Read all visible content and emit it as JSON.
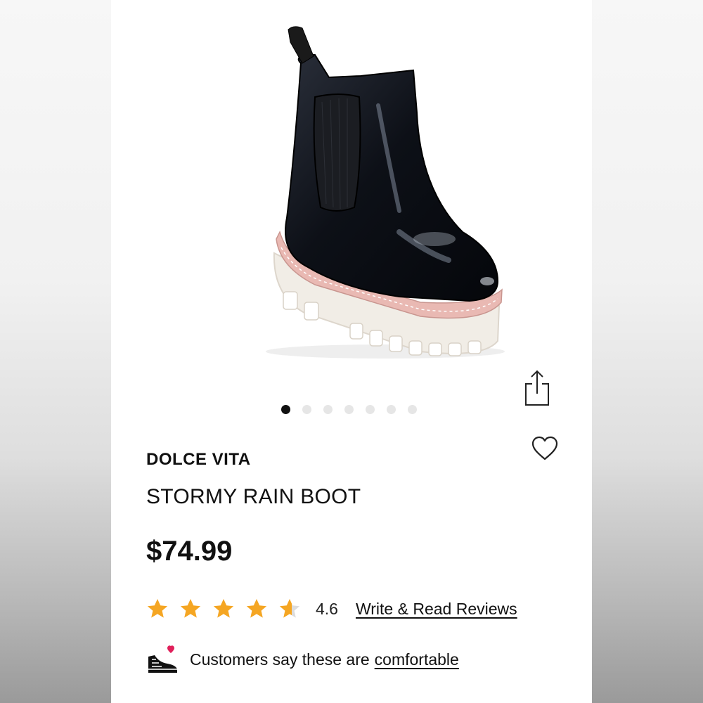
{
  "product": {
    "brand": "DOLCE VITA",
    "name": "STORMY RAIN BOOT",
    "price": "$74.99",
    "image_icon": "black-chelsea-rain-boot-photo"
  },
  "gallery": {
    "image_count": 7,
    "active_index": 0
  },
  "actions": {
    "share_icon": "share-icon",
    "wishlist_icon": "heart-outline-icon"
  },
  "rating": {
    "value": "4.6",
    "stars": 4.6,
    "max_stars": 5,
    "reviews_link": "Write & Read Reviews"
  },
  "comfort": {
    "icon": "sneaker-heart-icon",
    "text": "Customers say these are",
    "link": "comfortable"
  },
  "colors": {
    "star_fill": "#f5a623",
    "star_empty": "#dcdcdc",
    "text": "#111111",
    "heart_accent": "#e0205a"
  }
}
